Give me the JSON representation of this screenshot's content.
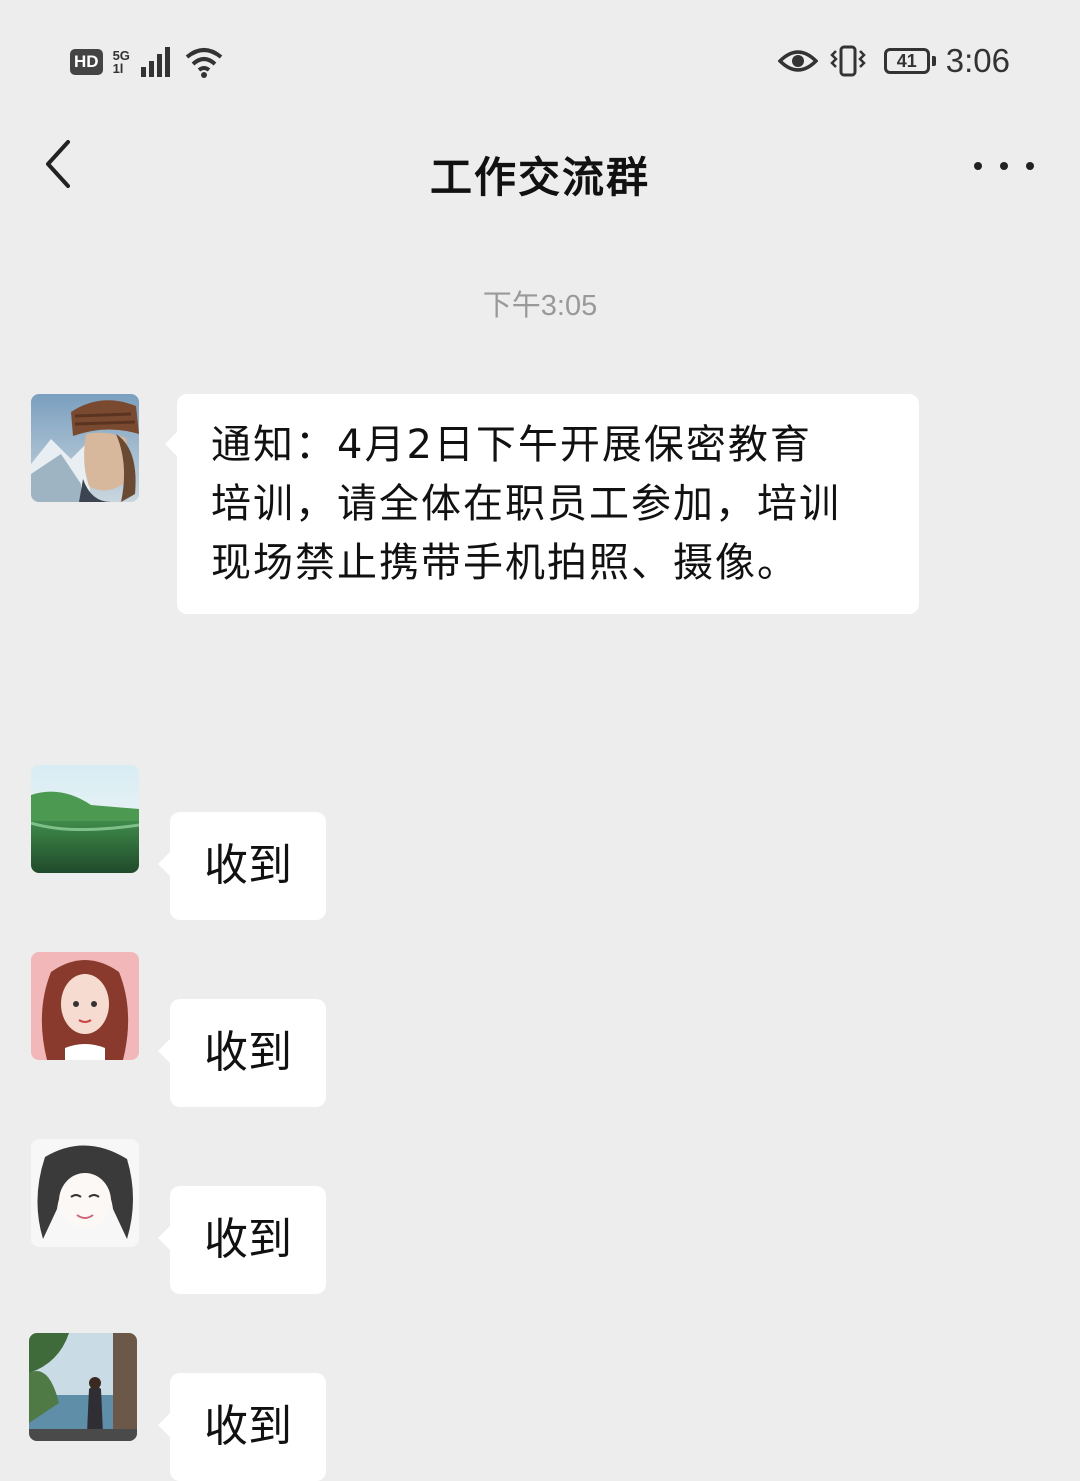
{
  "status_bar": {
    "hd": "HD",
    "network_top": "5G",
    "network_bottom": "1l",
    "icons": [
      "signal-icon",
      "wifi-icon",
      "eye-icon",
      "vibrate-icon"
    ],
    "battery": "41",
    "time": "3:06"
  },
  "header": {
    "back_icon": "chevron-left-icon",
    "title": "工作交流群",
    "more_icon": "more-dots-icon"
  },
  "timestamp": "下午3:05",
  "messages": [
    {
      "avatar": "avatar-woman-beanie",
      "lines": [
        "通知：4月2日下午开展保密教育",
        "培训，请全体在职员工参加，培训",
        "现场禁止携带手机拍照、摄像。"
      ]
    },
    {
      "avatar": "avatar-lake-landscape",
      "text": "收到"
    },
    {
      "avatar": "avatar-pink-cartoon-girl",
      "text": "收到"
    },
    {
      "avatar": "avatar-sketch-girl",
      "text": "收到"
    },
    {
      "avatar": "avatar-seaside-photo",
      "text": "收到"
    }
  ],
  "colors": {
    "background": "#ededed",
    "bubble": "#ffffff",
    "timestamp": "#999999"
  }
}
